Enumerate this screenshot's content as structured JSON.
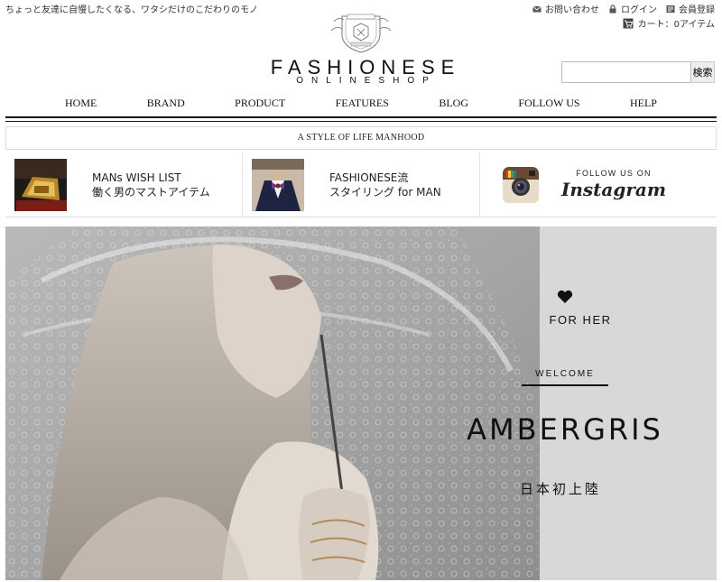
{
  "header": {
    "tagline": "ちょっと友達に自慢したくなる、ワタシだけのこだわりのモノ",
    "utility": {
      "contact": "お問い合わせ",
      "login": "ログイン",
      "register": "会員登録"
    },
    "cart": "カート：0アイテム",
    "logo_main": "FASHIONESE",
    "logo_sub": "ONLINESHOP",
    "search": {
      "value": "",
      "button": "検索"
    }
  },
  "nav": [
    {
      "label": "HOME"
    },
    {
      "label": "BRAND"
    },
    {
      "label": "PRODUCT"
    },
    {
      "label": "FEATURES"
    },
    {
      "label": "BLOG"
    },
    {
      "label": "FOLLOW US"
    },
    {
      "label": "HELP"
    }
  ],
  "style_bar": "A STYLE OF LIFE MANHOOD",
  "features": [
    {
      "line1": "MANs WISH LIST",
      "line2": "働く男のマストアイテム"
    },
    {
      "line1": "FASHIONESE流",
      "line2": "スタイリング for MAN"
    },
    {
      "follow": "FOLLOW US ON",
      "brand": "Instagram"
    }
  ],
  "hero": {
    "for_her": "FOR HER",
    "welcome": "WELCOME",
    "title": "AMBERGRIS",
    "subtitle": "日本初上陸"
  }
}
